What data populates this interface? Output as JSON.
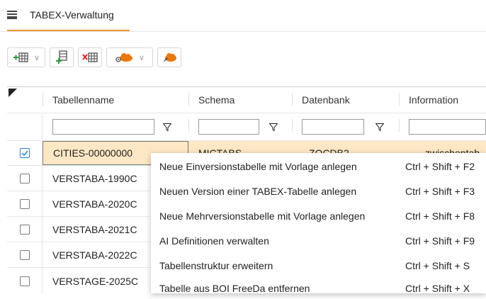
{
  "tabs": [
    {
      "label": "TABEX-Verwaltung"
    }
  ],
  "toolbar": {
    "buttons": [
      {
        "name": "add-table-icon",
        "split": true
      },
      {
        "name": "add-version-icon",
        "split": false
      },
      {
        "name": "delete-table-icon",
        "split": false
      },
      {
        "name": "cloud-view-icon",
        "split": true
      },
      {
        "name": "cloud-rocket-icon",
        "split": false
      }
    ]
  },
  "grid": {
    "columns": [
      "Tabellenname",
      "Schema",
      "Datenbank",
      "Information"
    ],
    "rows": [
      {
        "checked": true,
        "name": "CITIES-00000000",
        "schema": "MICTABS",
        "db": "ZOCDB2",
        "info": "zwischentab"
      },
      {
        "checked": false,
        "name": "VERSTABA-1990C"
      },
      {
        "checked": false,
        "name": "VERSTABA-2020C"
      },
      {
        "checked": false,
        "name": "VERSTABA-2021C"
      },
      {
        "checked": false,
        "name": "VERSTABA-2022C"
      },
      {
        "checked": false,
        "name": "VERSTAGE-2025C"
      }
    ]
  },
  "context_menu": {
    "items": [
      {
        "label": "Neue Einversionstabelle mit Vorlage anlegen",
        "shortcut": "Ctrl + Shift + F2"
      },
      {
        "label": "Neuen Version einer TABEX-Tabelle anlegen",
        "shortcut": "Ctrl + Shift + F3"
      },
      {
        "label": "Neue Mehrversionstabelle mit Vorlage anlegen",
        "shortcut": "Ctrl + Shift + F8"
      },
      {
        "label": "AI Definitionen verwalten",
        "shortcut": "Ctrl + Shift + F9"
      },
      {
        "label": "Tabellenstruktur erweitern",
        "shortcut": "Ctrl + Shift + S"
      },
      {
        "label": "Tabelle aus BOI FreeDa entfernen",
        "shortcut": "Ctrl + Shift + X"
      }
    ]
  },
  "colors": {
    "accent": "#f0922e",
    "selected_row": "#fde7c4",
    "checkbox_on": "#2a7fd4"
  }
}
